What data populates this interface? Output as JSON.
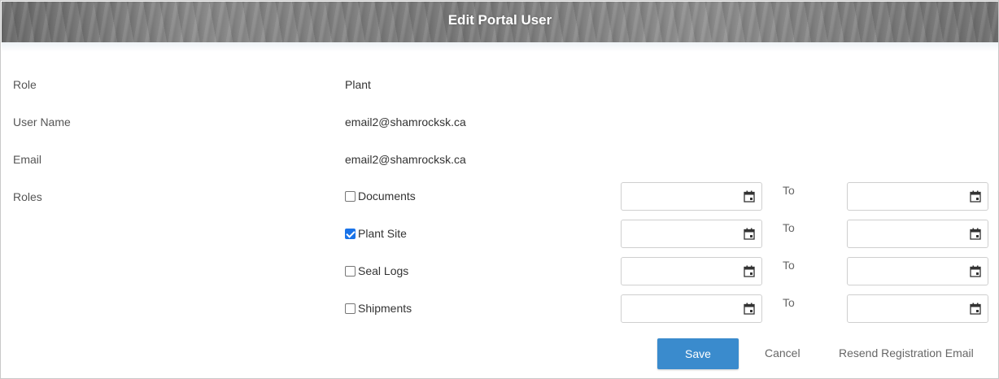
{
  "dialog": {
    "title": "Edit Portal User"
  },
  "fields": {
    "role": {
      "label": "Role",
      "value": "Plant"
    },
    "user_name": {
      "label": "User Name",
      "value": "email2@shamrocksk.ca"
    },
    "email": {
      "label": "Email",
      "value": "email2@shamrocksk.ca"
    },
    "roles_label": "Roles"
  },
  "roles": [
    {
      "label": "Documents",
      "checked": false,
      "from": "",
      "to": ""
    },
    {
      "label": "Plant Site",
      "checked": true,
      "from": "",
      "to": ""
    },
    {
      "label": "Seal Logs",
      "checked": false,
      "from": "",
      "to": ""
    },
    {
      "label": "Shipments",
      "checked": false,
      "from": "",
      "to": ""
    }
  ],
  "to_label": "To",
  "actions": {
    "save": "Save",
    "cancel": "Cancel",
    "resend": "Resend Registration Email"
  },
  "colors": {
    "primary": "#3a8bcd",
    "checkbox_checked": "#1a73e8"
  },
  "icons": {
    "date_picker": "calendar-icon"
  }
}
